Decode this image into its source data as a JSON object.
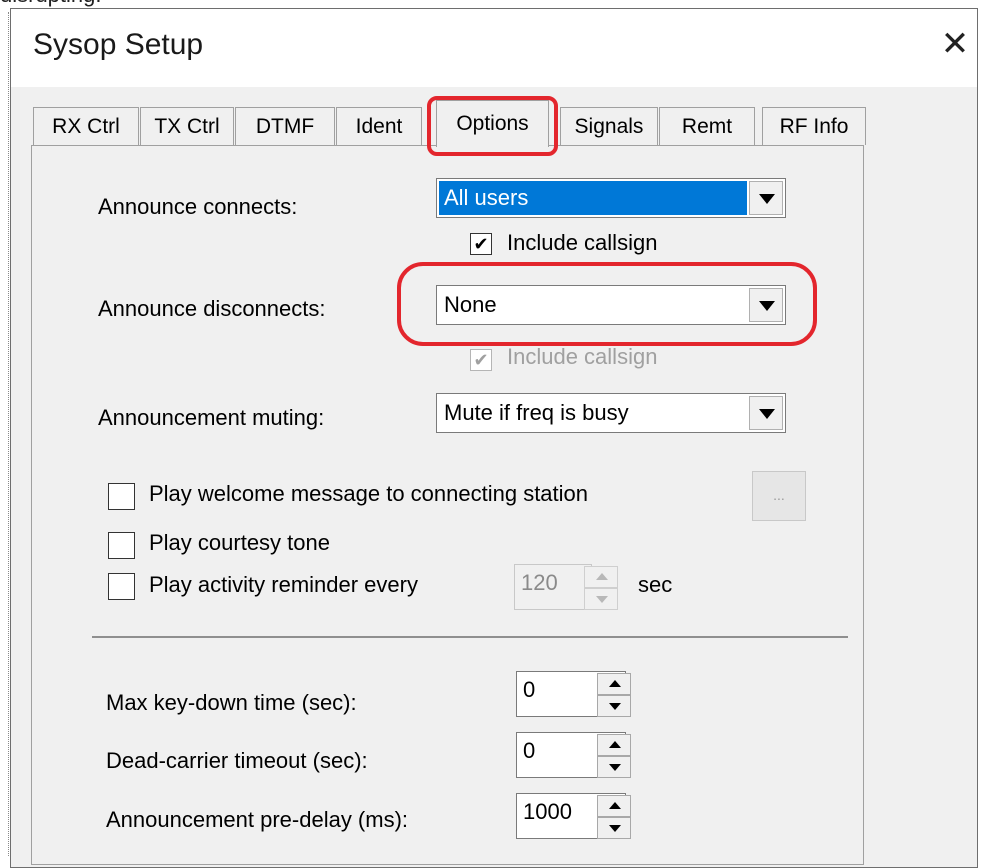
{
  "fragment": "disrupting.",
  "dialog": {
    "title": "Sysop Setup",
    "close_glyph": "✕"
  },
  "tabs": [
    "RX Ctrl",
    "TX Ctrl",
    "DTMF",
    "Ident",
    "Options",
    "Signals",
    "Remt",
    "RF Info"
  ],
  "active_tab": "Options",
  "options": {
    "announce_connects": {
      "label": "Announce connects:",
      "value": "All users"
    },
    "include_callsign_1": {
      "label": "Include callsign",
      "checked": true
    },
    "announce_disconnects": {
      "label": "Announce disconnects:",
      "value": "None"
    },
    "include_callsign_2": {
      "label": "Include callsign",
      "checked": true,
      "disabled": true
    },
    "announcement_muting": {
      "label": "Announcement muting:",
      "value": "Mute if freq is busy"
    },
    "play_welcome": {
      "label": "Play welcome message to connecting station",
      "checked": false,
      "button_label": "..."
    },
    "play_courtesy": {
      "label": "Play courtesy tone",
      "checked": false
    },
    "play_reminder": {
      "label": "Play activity reminder every",
      "checked": false,
      "value": "120",
      "unit": "sec"
    },
    "max_keydown": {
      "label": "Max key-down time (sec):",
      "value": "0"
    },
    "dead_carrier": {
      "label": "Dead-carrier timeout (sec):",
      "value": "0"
    },
    "pre_delay": {
      "label": "Announcement pre-delay (ms):",
      "value": "1000"
    }
  },
  "colors": {
    "highlight_ring": "#e3262d",
    "selection": "#0078d7",
    "dialog_bg": "#f0f0f0"
  },
  "icons": {
    "close": "close-icon",
    "dropdown": "chevron-down-icon",
    "spin_up": "arrow-up-icon",
    "spin_down": "arrow-down-icon",
    "checkmark": "checkmark-icon"
  }
}
